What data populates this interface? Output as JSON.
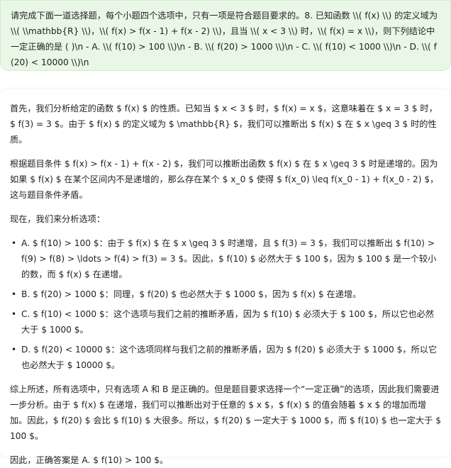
{
  "user_message": {
    "text": "请完成下面一道选择题，每个小题四个选项中，只有一项是符合题目要求的。8. 已知函数 \\\\( f(x) \\\\) 的定义域为 \\\\( \\\\mathbb{R} \\\\)，\\\\( f(x) > f(x - 1) + f(x - 2) \\\\)，且当 \\\\( x < 3 \\\\) 时，\\\\( f(x) = x \\\\)，则下列结论中一定正确的是 ( )\\n   - A. \\\\( f(10) > 100 \\\\)\\n   - B. \\\\( f(20) > 1000 \\\\)\\n   - C. \\\\( f(10) < 1000 \\\\)\\n   - D. \\\\( f(20) < 10000 \\\\)\\n"
  },
  "assistant_message": {
    "p1": "首先，我们分析给定的函数 $ f(x) $ 的性质。已知当 $ x < 3 $ 时，$ f(x) = x $，这意味着在 $ x = 3 $ 时，$ f(3) = 3 $。由于 $ f(x) $ 的定义域为 $ \\mathbb{R} $，我们可以推断出 $ f(x) $ 在 $ x \\geq 3 $ 时的性质。",
    "p2": "根据题目条件 $ f(x) > f(x - 1) + f(x - 2) $，我们可以推断出函数 $ f(x) $ 在 $ x \\geq 3 $ 时是递增的。因为如果 $ f(x) $ 在某个区间内不是递增的，那么存在某个 $ x_0 $ 使得 $ f(x_0) \\leq f(x_0 - 1) + f(x_0 - 2) $，这与题目条件矛盾。",
    "p3": "现在，我们来分析选项：",
    "options": [
      "A. $ f(10) > 100 $：由于 $ f(x) $ 在 $ x \\geq 3 $ 时递增，且 $ f(3) = 3 $，我们可以推断出 $ f(10) > f(9) > f(8) > \\ldots > f(4) > f(3) = 3 $。因此，$ f(10) $ 必然大于 $ 100 $，因为 $ 100 $ 是一个较小的数，而 $ f(x) $ 在递增。",
      "B. $ f(20) > 1000 $：同理，$ f(20) $ 也必然大于 $ 1000 $，因为 $ f(x) $ 在递增。",
      "C. $ f(10) < 1000 $：这个选项与我们之前的推断矛盾，因为 $ f(10) $ 必须大于 $ 100 $，所以它也必然大于 $ 1000 $。",
      "D. $ f(20) < 10000 $：这个选项同样与我们之前的推断矛盾，因为 $ f(20) $ 必须大于 $ 1000 $，所以它也必然大于 $ 10000 $。"
    ],
    "p4": "综上所述，所有选项中，只有选项 A 和 B 是正确的。但是题目要求选择一个“一定正确”的选项，因此我们需要进一步分析。由于 $ f(x) $ 在递增，我们可以推断出对于任意的 $ x $，$ f(x) $ 的值会随着 $ x $ 的增加而增加。因此，$ f(20) $ 会比 $ f(10) $ 大很多。所以，$ f(20) $ 一定大于 $ 1000 $，而 $ f(10) $ 也一定大于 $ 100 $。",
    "p5": "因此，正确答案是 A. $ f(10) > 100 $。"
  },
  "colors": {
    "user_bubble_bg": "#e9f8e6",
    "assistant_bg": "#ffffff",
    "text": "#1f1f1f"
  }
}
